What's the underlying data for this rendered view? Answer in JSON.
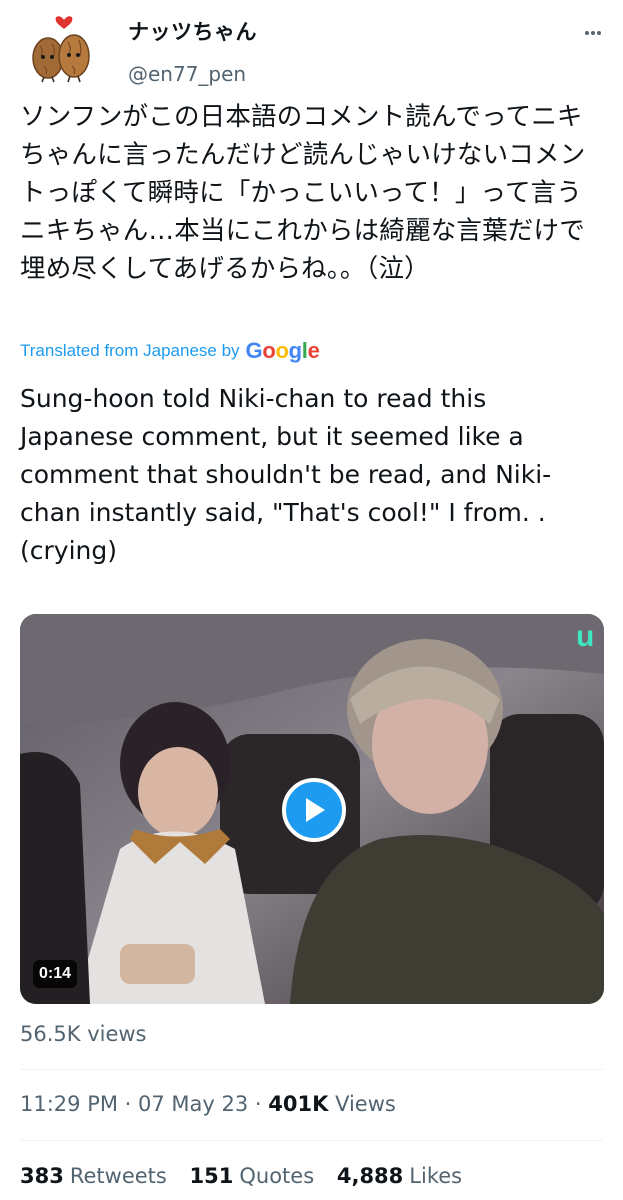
{
  "author": {
    "display_name": "ナッツちゃん",
    "handle": "@en77_pen"
  },
  "tweet": {
    "text": "ソンフンがこの日本語のコメント読んでってニキちゃんに言ったんだけど読んじゃいけないコメントっぽくて瞬時に「かっこいいって！」って言うニキちゃん…本当にこれからは綺麗な言葉だけで埋め尽くしてあげるからね。。（泣）",
    "translated_label": "Translated from Japanese by",
    "translation_provider": "Google",
    "translation": "Sung-hoon told Niki-chan to read this Japanese comment, but it seemed like a comment that shouldn't be read, and Niki-chan instantly said, \"That's cool!\" I from. . (crying)"
  },
  "video": {
    "duration": "0:14",
    "views": "56.5K views"
  },
  "meta": {
    "time": "11:29 PM",
    "separator": " · ",
    "date": "07 May 23",
    "views_count": "401K",
    "views_label": "Views"
  },
  "stats": {
    "retweets_count": "383",
    "retweets_label": "Retweets",
    "quotes_count": "151",
    "quotes_label": "Quotes",
    "likes_count": "4,888",
    "likes_label": "Likes"
  },
  "colors": {
    "accent": "#1d9bf0",
    "secondary_text": "#536471"
  }
}
